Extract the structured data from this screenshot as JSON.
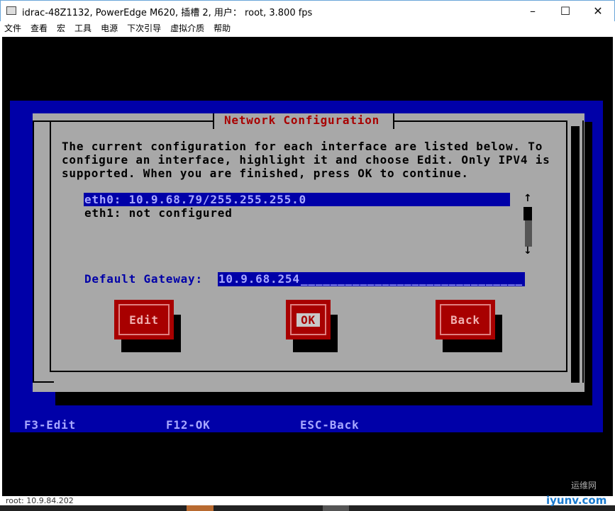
{
  "window": {
    "title": "idrac-48Z1132, PowerEdge M620,  插槽 2, 用户： root, 3.800 fps",
    "minimize": "–",
    "maximize": "☐",
    "close": "✕"
  },
  "menu": [
    "文件",
    "查看",
    "宏",
    "工具",
    "电源",
    "下次引导",
    "虚拟介质",
    "帮助"
  ],
  "dialog": {
    "title": "Network Configuration",
    "description": "The current configuration for each interface are listed below. To\nconfigure an interface, highlight it and choose Edit. Only IPV4 is\nsupported. When you are finished, press OK to continue.",
    "interfaces": [
      {
        "label": "eth0: 10.9.68.79/255.255.255.0",
        "selected": true
      },
      {
        "label": "eth1: not configured",
        "selected": false
      }
    ],
    "scroll_up": "↑",
    "scroll_down": "↓",
    "gateway_label": "Default Gateway:",
    "gateway_value": "10.9.68.254",
    "buttons": {
      "edit": "Edit",
      "ok": "OK",
      "back": "Back"
    }
  },
  "footer": {
    "f3": "F3-Edit",
    "f12": "F12-OK",
    "esc": "ESC-Back"
  },
  "status": "root: 10.9.84.202",
  "watermark": {
    "cn": "运维网",
    "en": "iyunv.com"
  },
  "colors": {
    "console_blue": "#0000a8",
    "dialog_gray": "#a8a8a8",
    "button_red": "#a80000"
  }
}
